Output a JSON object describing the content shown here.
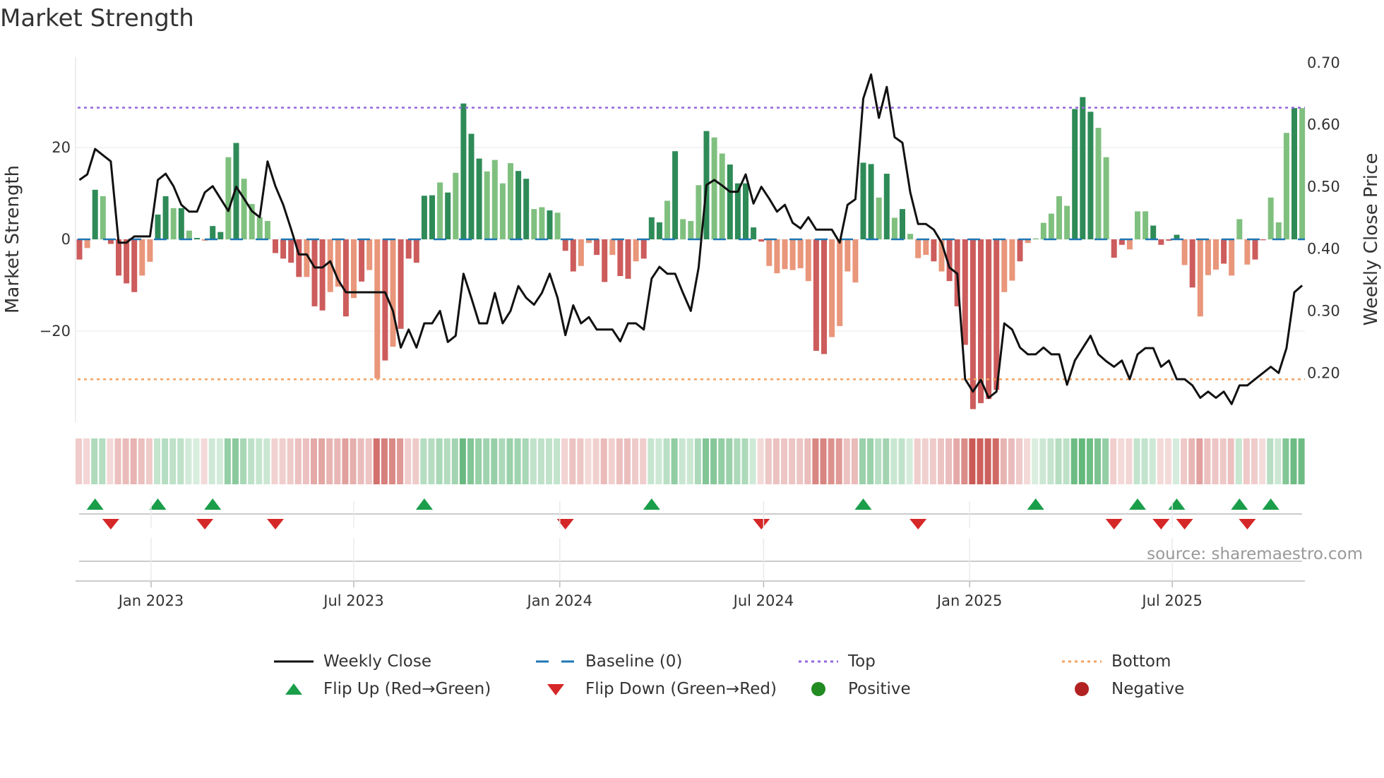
{
  "title": "Market Strength",
  "source": "source: sharemaestro.com",
  "chart_data": {
    "type": "bar",
    "title": "Market Strength",
    "ylabel": "Market Strength",
    "y2label": "Weekly Close Price",
    "ylim": [
      -40,
      40
    ],
    "y2lim": [
      0.121,
      0.708
    ],
    "yticks": [
      {
        "v": -20,
        "label": "−20"
      },
      {
        "v": 0,
        "label": "0"
      },
      {
        "v": 20,
        "label": "20"
      }
    ],
    "y2ticks": [
      {
        "v": 0.2,
        "label": "0.20"
      },
      {
        "v": 0.3,
        "label": "0.30"
      },
      {
        "v": 0.4,
        "label": "0.40"
      },
      {
        "v": 0.5,
        "label": "0.50"
      },
      {
        "v": 0.6,
        "label": "0.60"
      },
      {
        "v": 0.7,
        "label": "0.70"
      }
    ],
    "xticks": [
      {
        "date": "2023-01-01",
        "label": "Jan 2023"
      },
      {
        "date": "2023-07-01",
        "label": "Jul 2023"
      },
      {
        "date": "2024-01-01",
        "label": "Jan 2024"
      },
      {
        "date": "2024-07-01",
        "label": "Jul 2024"
      },
      {
        "date": "2025-01-01",
        "label": "Jan 2025"
      },
      {
        "date": "2025-07-01",
        "label": "Jul 2025"
      }
    ],
    "first_week": "2022-10-29",
    "frequency": "weekly",
    "top_level": 28.7,
    "bottom_level": -30.5,
    "baseline": 0,
    "strength": [
      -4.4,
      -1.9,
      10.8,
      9.4,
      -1,
      -7.9,
      -9.6,
      -11.5,
      -7.9,
      -4.9,
      5.4,
      9.4,
      6.8,
      6.8,
      1.9,
      0.3,
      -0.3,
      2.9,
      1.6,
      17.9,
      21,
      13.2,
      7.7,
      4.8,
      4,
      -3,
      -4.2,
      -5.1,
      -8.2,
      -8.2,
      -14.6,
      -15.5,
      -11.5,
      -10.3,
      -16.8,
      -12.8,
      -9.2,
      -6.7,
      -30.3,
      -26.4,
      -23.4,
      -19.5,
      -4.2,
      -5.1,
      9.5,
      9.6,
      12.4,
      10.2,
      14.5,
      29.6,
      23,
      17.6,
      14.8,
      17.3,
      12.2,
      16.6,
      14.9,
      13.2,
      6.6,
      7,
      6.3,
      5.8,
      -2.5,
      -7,
      -5.8,
      -0.8,
      -3.4,
      -9.3,
      -3.4,
      -8,
      -8.6,
      -4.8,
      -4.2,
      4.8,
      3.7,
      8.4,
      19.2,
      4.4,
      4,
      11.8,
      23.6,
      22.2,
      18.7,
      16.3,
      12.2,
      12.2,
      2.6,
      -0.5,
      -5.8,
      -7.4,
      -6.5,
      -6.7,
      -6.3,
      -9.1,
      -24.3,
      -25,
      -21.3,
      -18.9,
      -7,
      -9.4,
      16.7,
      16.4,
      9.1,
      14.3,
      4.7,
      6.6,
      1.2,
      -4.1,
      -3.4,
      -4.8,
      -7,
      -9.1,
      -14.6,
      -23,
      -37,
      -35.7,
      -34.8,
      -32.8,
      -11.5,
      -9,
      -4.8,
      -0.8,
      0.2,
      3.6,
      5.6,
      9.4,
      7.3,
      28.4,
      31,
      27.8,
      24.3,
      17.9,
      -4,
      -1.2,
      -2.2,
      6.1,
      6.1,
      3,
      -1.2,
      -0.3,
      1,
      -5.6,
      -10.5,
      -16.8,
      -7.8,
      -6.6,
      -5.3,
      -7.9,
      4.4,
      -5.5,
      -4.4,
      -0.2,
      9.1,
      3.7,
      23.2,
      28.6,
      28.6
    ],
    "shade": "rlgglrrrllggggggrgggggggrrrrlrrllrllrlllrggggggggggggggggggrrlrrlrrllggggggggggggggrrlrlrrrllrrggggggggrllrrrrrrllrllllggggggggggrlrgggrlgrrrlllrgrllgggggg",
    "shade_dark": "1010111100110101011010000111101100101001011111010111000011001011001101101110100010011111000000110000110101000101111111001000000111001100011110100010001100010011111",
    "weekly_close": [
      0.511,
      0.52,
      0.561,
      0.551,
      0.541,
      0.41,
      0.41,
      0.42,
      0.42,
      0.42,
      0.511,
      0.521,
      0.501,
      0.471,
      0.46,
      0.46,
      0.491,
      0.501,
      0.481,
      0.461,
      0.5,
      0.481,
      0.461,
      0.451,
      0.541,
      0.501,
      0.471,
      0.432,
      0.391,
      0.391,
      0.37,
      0.37,
      0.38,
      0.35,
      0.33,
      0.33,
      0.33,
      0.33,
      0.33,
      0.33,
      0.3,
      0.241,
      0.27,
      0.241,
      0.28,
      0.28,
      0.3,
      0.25,
      0.26,
      0.36,
      0.321,
      0.28,
      0.28,
      0.329,
      0.28,
      0.3,
      0.34,
      0.321,
      0.31,
      0.329,
      0.36,
      0.321,
      0.261,
      0.309,
      0.28,
      0.29,
      0.27,
      0.27,
      0.27,
      0.251,
      0.28,
      0.28,
      0.27,
      0.352,
      0.371,
      0.36,
      0.36,
      0.329,
      0.3,
      0.37,
      0.503,
      0.511,
      0.502,
      0.492,
      0.492,
      0.52,
      0.473,
      0.5,
      0.481,
      0.46,
      0.471,
      0.442,
      0.433,
      0.451,
      0.431,
      0.431,
      0.431,
      0.41,
      0.471,
      0.48,
      0.642,
      0.681,
      0.611,
      0.661,
      0.58,
      0.571,
      0.491,
      0.44,
      0.44,
      0.431,
      0.41,
      0.37,
      0.36,
      0.19,
      0.17,
      0.189,
      0.16,
      0.17,
      0.28,
      0.27,
      0.241,
      0.23,
      0.23,
      0.241,
      0.23,
      0.23,
      0.181,
      0.22,
      0.24,
      0.26,
      0.23,
      0.219,
      0.21,
      0.22,
      0.19,
      0.23,
      0.24,
      0.24,
      0.21,
      0.22,
      0.19,
      0.19,
      0.18,
      0.16,
      0.17,
      0.16,
      0.17,
      0.15,
      0.18,
      0.18,
      0.19,
      0.2,
      0.21,
      0.2,
      0.24,
      0.33,
      0.341
    ],
    "flip_up_weeks": [
      2,
      10,
      17,
      44,
      73,
      100,
      122,
      135,
      140,
      148,
      152
    ],
    "flip_down_weeks": [
      4,
      16,
      25,
      62,
      87,
      107,
      132,
      138,
      141,
      149
    ],
    "legend": {
      "placement": "bottom",
      "items": [
        {
          "label": "Weekly Close",
          "symbol": "line"
        },
        {
          "label": "Baseline (0)",
          "symbol": "dash"
        },
        {
          "label": "Top",
          "symbol": "dot-purple"
        },
        {
          "label": "Bottom",
          "symbol": "dot-orange"
        },
        {
          "label": "Flip Up (Red→Green)",
          "symbol": "tri-up"
        },
        {
          "label": "Flip Down (Green→Red)",
          "symbol": "tri-down"
        },
        {
          "label": "Positive",
          "symbol": "circle-green"
        },
        {
          "label": "Negative",
          "symbol": "circle-red"
        }
      ]
    },
    "colors": {
      "pos_dark": "#2e8b57",
      "pos_light": "#80c07f",
      "neg_dark": "#cd5c5c",
      "neg_light": "#e9967a",
      "line": "#111111",
      "baseline": "#1f77b4",
      "top": "#9467dd",
      "bottom": "#f4a261",
      "flip_up": "#1a9e4a",
      "flip_down": "#d62728",
      "positive": "#228b22",
      "negative": "#b22222"
    }
  }
}
